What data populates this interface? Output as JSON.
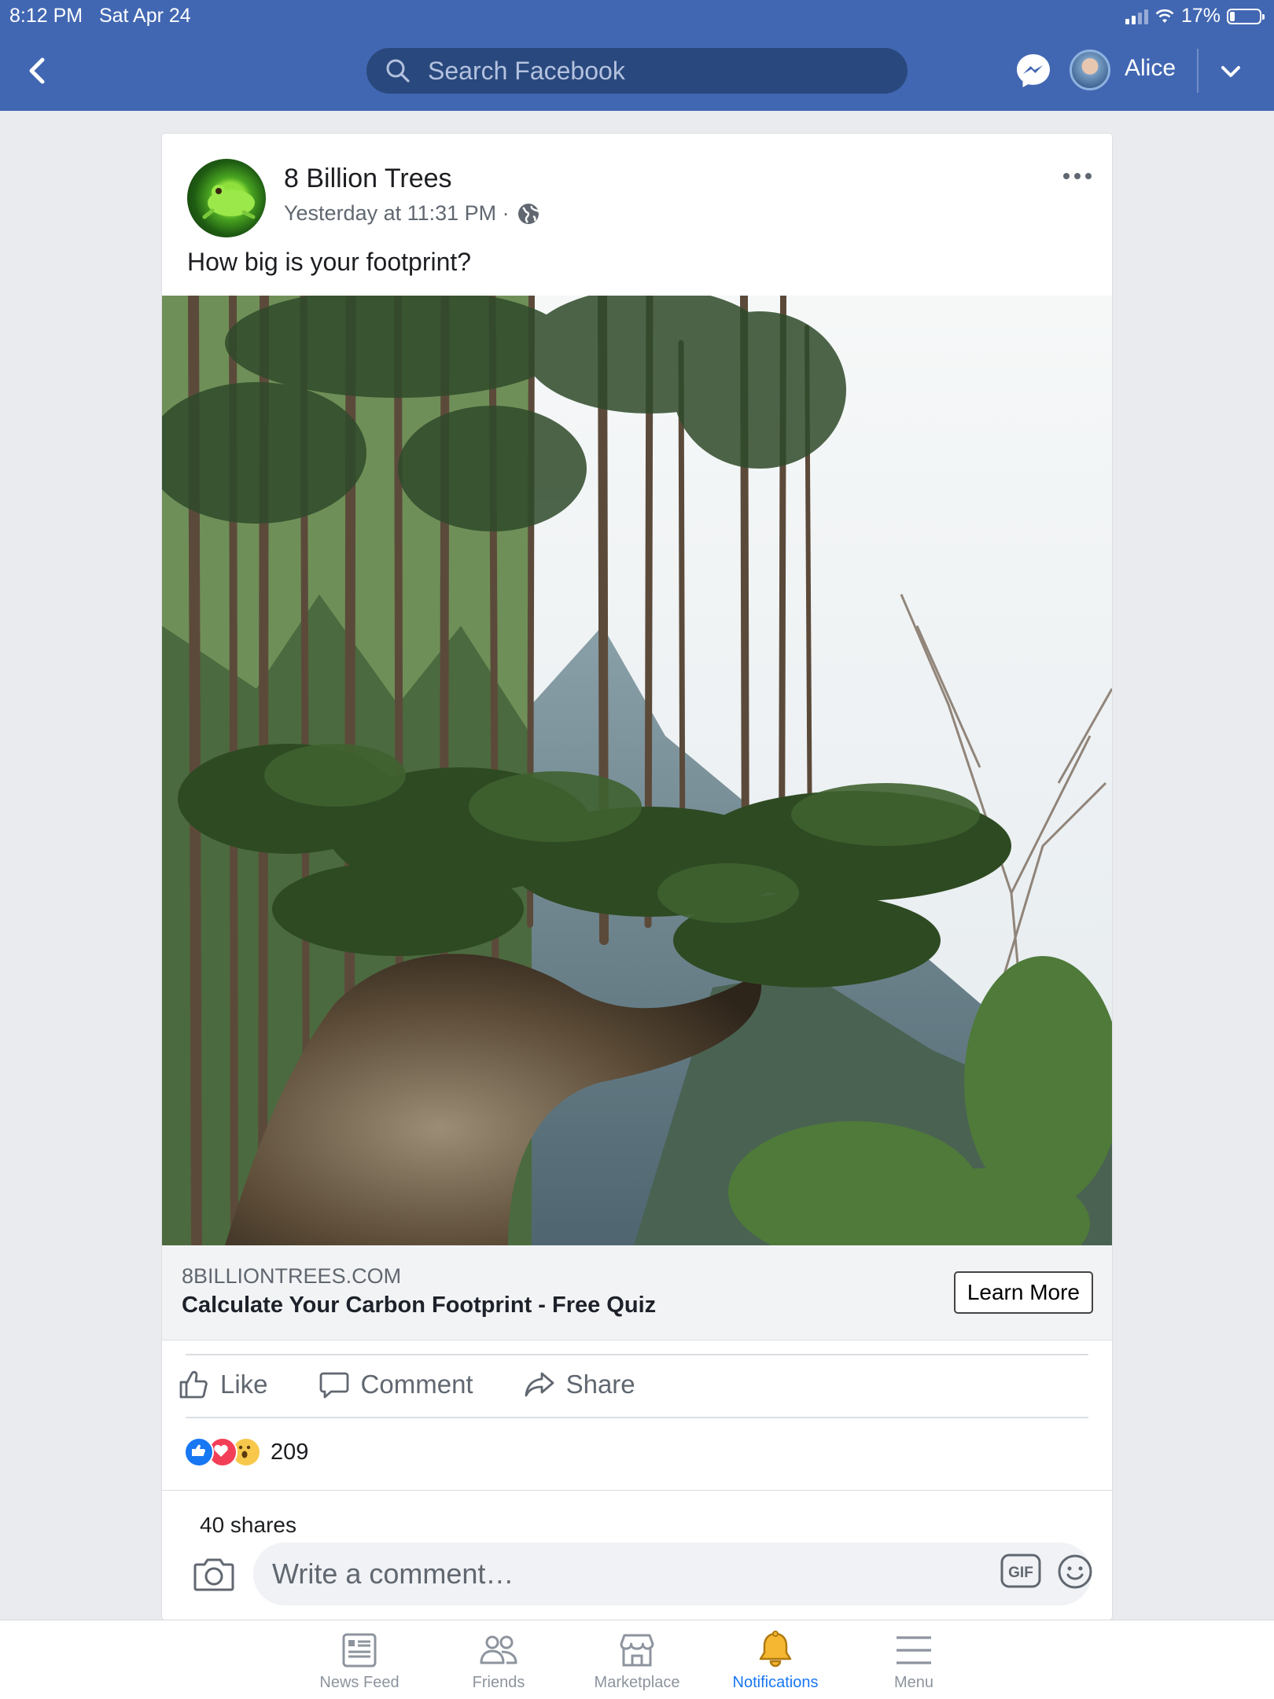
{
  "status_bar": {
    "time": "8:12 PM",
    "date": "Sat Apr 24",
    "battery": "17%",
    "battery_level": 0.17
  },
  "header": {
    "search_placeholder": "Search Facebook",
    "user_name": "Alice",
    "icons": [
      "back-chevron-icon",
      "search-icon",
      "messenger-icon",
      "avatar",
      "chevron-down-icon"
    ]
  },
  "post": {
    "page_name": "8 Billion Trees",
    "timestamp": "Yesterday at 11:31 PM ·",
    "text": "How big is your footprint?",
    "link": {
      "domain": "8BILLIONTREES.COM",
      "title": "Calculate Your Carbon Footprint - Free Quiz",
      "button": "Learn More"
    },
    "actions": {
      "like": "Like",
      "comment": "Comment",
      "share": "Share"
    },
    "reaction_count": "209",
    "shares": "40 shares",
    "comment_placeholder": "Write a comment…"
  },
  "tabbar": {
    "items": [
      {
        "label": "News Feed",
        "icon": "news-feed-icon",
        "active": false
      },
      {
        "label": "Friends",
        "icon": "friends-icon",
        "active": false
      },
      {
        "label": "Marketplace",
        "icon": "marketplace-icon",
        "active": false
      },
      {
        "label": "Notifications",
        "icon": "bell-icon",
        "active": true
      },
      {
        "label": "Menu",
        "icon": "menu-icon",
        "active": false
      }
    ]
  },
  "colors": {
    "brand": "#4267b2",
    "search_bg": "#29487d",
    "active_tab": "#1877f2",
    "bell": "#f5b731"
  }
}
